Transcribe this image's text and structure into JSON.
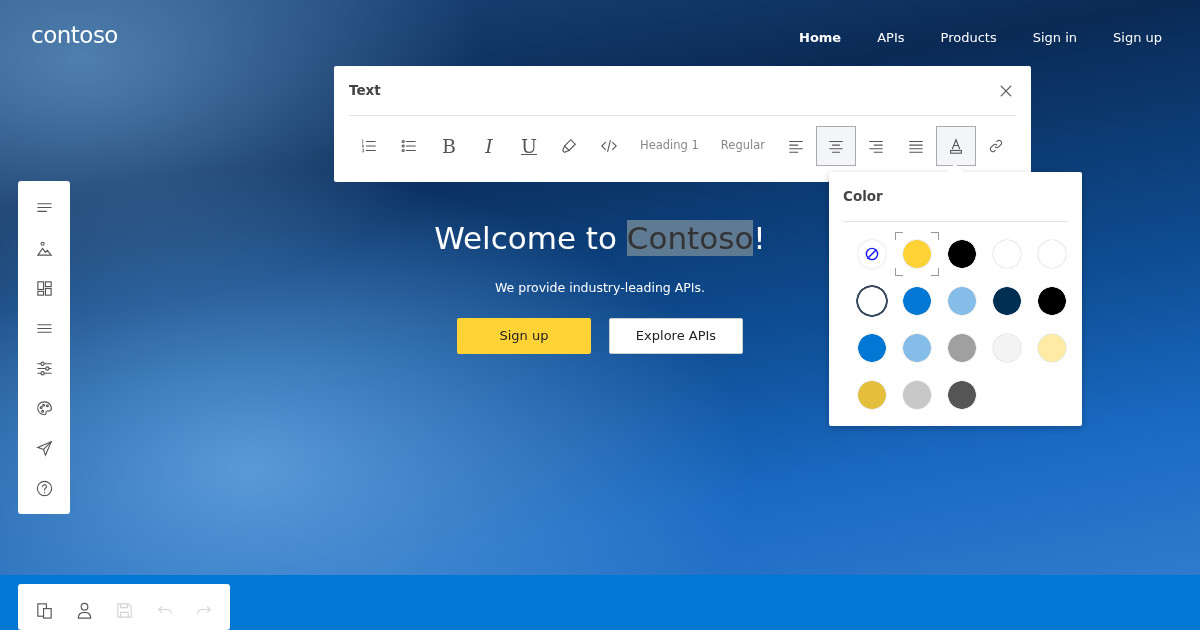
{
  "logo": "contoso",
  "nav": [
    {
      "label": "Home",
      "selected": true
    },
    {
      "label": "APIs",
      "selected": false
    },
    {
      "label": "Products",
      "selected": false
    },
    {
      "label": "Sign in",
      "selected": false
    },
    {
      "label": "Sign up",
      "selected": false
    }
  ],
  "hero": {
    "headline": [
      {
        "text": "Welcome to ",
        "selected": false
      },
      {
        "text": "Contoso",
        "selected": true
      },
      {
        "text": "!",
        "selected": false
      }
    ],
    "subtitle": "We provide industry-leading APIs.",
    "buttons": [
      {
        "label": "Sign up",
        "kind": "primary"
      },
      {
        "label": "Explore APIs",
        "kind": "secondary"
      }
    ]
  },
  "text_panel": {
    "title": "Text",
    "tools": [
      {
        "kind": "ordered-list",
        "selected": false
      },
      {
        "kind": "bullet-list",
        "selected": false
      },
      {
        "kind": "bold",
        "label": "B",
        "selected": false
      },
      {
        "kind": "italic",
        "label": "I",
        "selected": false
      },
      {
        "kind": "underline",
        "label": "U",
        "selected": false
      },
      {
        "kind": "highlight",
        "selected": false
      },
      {
        "kind": "code",
        "selected": false
      },
      {
        "kind": "text",
        "label": "Heading 1",
        "selected": false
      },
      {
        "kind": "text",
        "label": "Regular",
        "selected": false
      },
      {
        "kind": "align-left",
        "selected": false
      },
      {
        "kind": "align-center",
        "selected": true
      },
      {
        "kind": "align-right",
        "selected": false
      },
      {
        "kind": "justify",
        "selected": false
      },
      {
        "kind": "font-color",
        "selected": true
      },
      {
        "kind": "link",
        "selected": false
      }
    ]
  },
  "color_panel": {
    "title": "Color",
    "swatches": [
      {
        "kind": "none",
        "selected": false
      },
      {
        "kind": "fill",
        "color": "#ffd335",
        "selected": true
      },
      {
        "kind": "fill",
        "color": "#000000",
        "selected": false
      },
      {
        "kind": "fill",
        "color": "#ffffff",
        "selected": false
      },
      {
        "kind": "fill",
        "color": "#ffffff",
        "selected": false
      },
      {
        "kind": "ring",
        "color": "#ffffff",
        "selected": false
      },
      {
        "kind": "fill",
        "color": "#0078d4",
        "selected": false
      },
      {
        "kind": "fill",
        "color": "#83bde8",
        "selected": false
      },
      {
        "kind": "fill",
        "color": "#002f54",
        "selected": false
      },
      {
        "kind": "fill",
        "color": "#000000",
        "selected": false
      },
      {
        "kind": "fill",
        "color": "#0078d4",
        "selected": false
      },
      {
        "kind": "fill",
        "color": "#83bde8",
        "selected": false
      },
      {
        "kind": "fill",
        "color": "#a0a0a0",
        "selected": false
      },
      {
        "kind": "fill",
        "color": "#f4f4f4",
        "selected": false
      },
      {
        "kind": "fill",
        "color": "#ffeaa6",
        "selected": false
      },
      {
        "kind": "fill",
        "color": "#e3bf3c",
        "selected": false
      },
      {
        "kind": "fill",
        "color": "#c8c8c8",
        "selected": false
      },
      {
        "kind": "fill",
        "color": "#555555",
        "selected": false
      }
    ]
  },
  "sidebar": [
    {
      "kind": "text"
    },
    {
      "kind": "image"
    },
    {
      "kind": "layout"
    },
    {
      "kind": "menu"
    },
    {
      "kind": "sliders"
    },
    {
      "kind": "palette"
    },
    {
      "kind": "send"
    },
    {
      "kind": "help"
    }
  ],
  "bottom_toolbar": [
    {
      "kind": "devices",
      "disabled": false
    },
    {
      "kind": "person",
      "disabled": false
    },
    {
      "kind": "save",
      "disabled": true
    },
    {
      "kind": "undo",
      "disabled": true
    },
    {
      "kind": "redo",
      "disabled": true
    }
  ]
}
